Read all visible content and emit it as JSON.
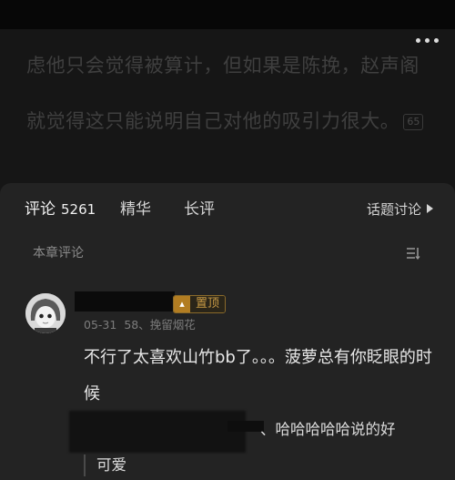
{
  "reader": {
    "text": "虑他只会觉得被算计，但如果是陈挽，赵声阁就觉得这只能说明自己对他的吸引力很大。",
    "paragraph_comment_count": "65",
    "more_icon": "more-dots-icon"
  },
  "comments_panel": {
    "tabs": [
      {
        "label": "评论",
        "count": "5261"
      },
      {
        "label": "精华"
      },
      {
        "label": "长评"
      }
    ],
    "topic_link": "话题讨论",
    "section_title": "本章评论",
    "sort_icon": "sort-icon"
  },
  "comment": {
    "pinned_label": "置顶",
    "date": "05-31",
    "level_info": "58、挽留烟花",
    "content": "不行了太喜欢山竹bb了。。。菠萝总有你眨眼的时候",
    "reply_preview_part1": "、哈哈哈哈哈说的好",
    "reply_preview_part2": "可爱"
  }
}
